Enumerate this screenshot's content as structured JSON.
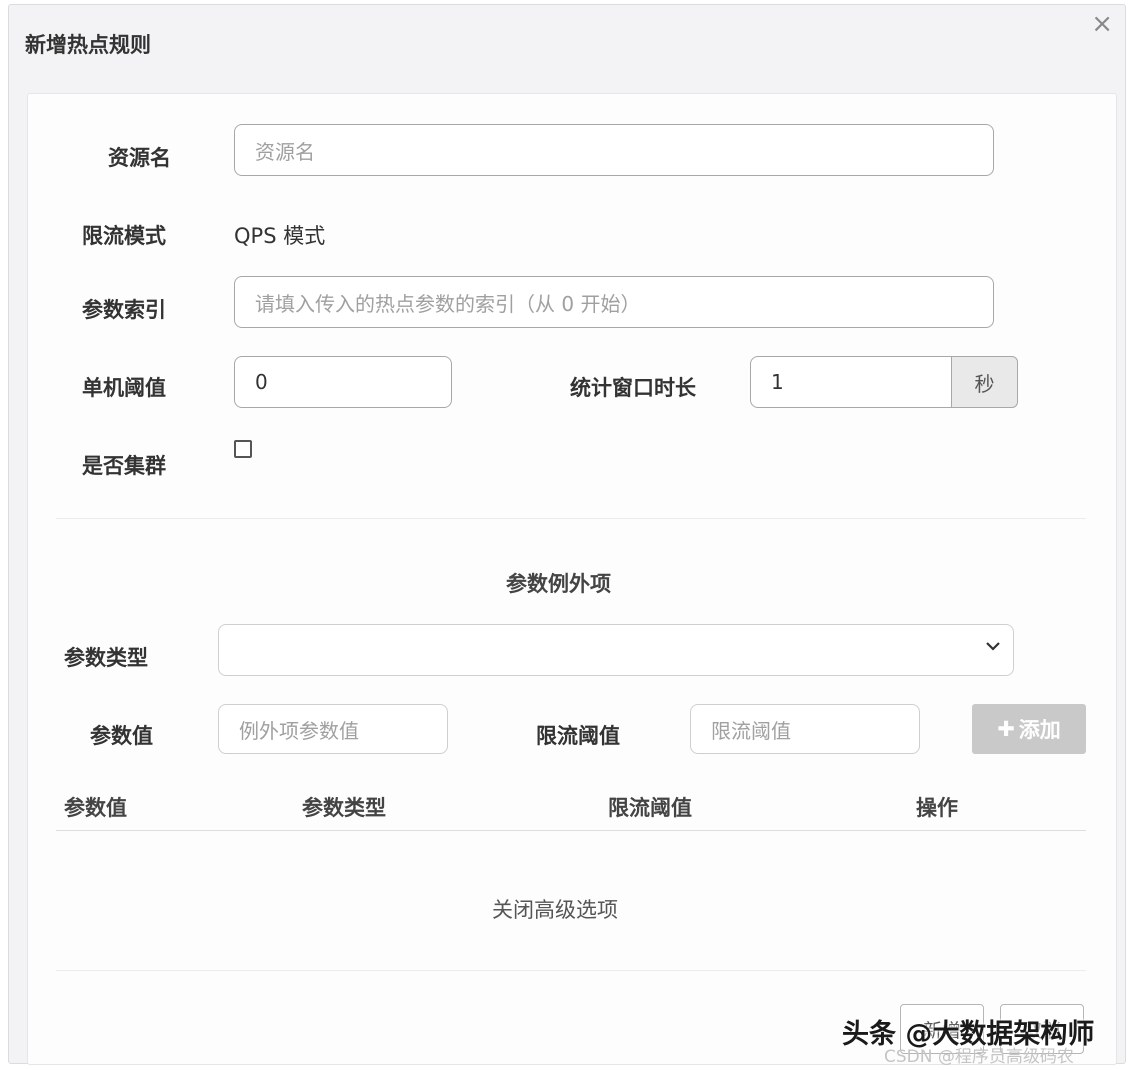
{
  "dialog": {
    "title": "新增热点规则",
    "close_icon": "close-icon"
  },
  "form": {
    "resource_label": "资源名",
    "resource_placeholder": "资源名",
    "mode_label": "限流模式",
    "mode_value": "QPS 模式",
    "param_index_label": "参数索引",
    "param_index_placeholder": "请填入传入的热点参数的索引（从 0 开始）",
    "threshold_label": "单机阈值",
    "threshold_value": "0",
    "window_label": "统计窗口时长",
    "window_value": "1",
    "window_unit": "秒",
    "cluster_label": "是否集群",
    "cluster_checked": false
  },
  "exceptions": {
    "section_title": "参数例外项",
    "type_label": "参数类型",
    "type_selected": "",
    "value_label": "参数值",
    "value_placeholder": "例外项参数值",
    "limit_label": "限流阈值",
    "limit_placeholder": "限流阈值",
    "add_button_label": "添加",
    "table_headers": [
      "参数值",
      "参数类型",
      "限流阈值",
      "操作"
    ]
  },
  "advanced_toggle": "关闭高级选项",
  "footer": {
    "confirm_label": "新增",
    "cancel_label": "取消"
  },
  "watermark": {
    "main": "头条 @大数据架构师",
    "sub": "CSDN @程序员高级码农"
  }
}
